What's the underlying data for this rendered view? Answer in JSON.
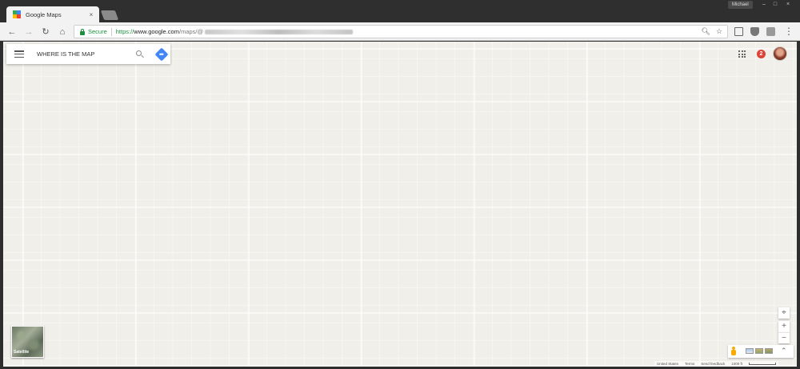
{
  "browser": {
    "tab_title": "Google Maps",
    "tab_close": "×",
    "profile_name": "Michael",
    "window_controls": {
      "minimize": "–",
      "maximize": "□",
      "close": "×"
    },
    "nav": {
      "back": "←",
      "forward": "→",
      "reload": "↻",
      "home": "⌂"
    },
    "omnibox": {
      "secure_label": "Secure",
      "url_scheme": "https://",
      "url_host": "www.google.com",
      "url_path": "/maps/@"
    },
    "omnibox_icons": {
      "zoom": "🔍︎",
      "bookmark": "☆"
    },
    "menu_icon": "⋮"
  },
  "map": {
    "search_value": "WHERE IS THE MAP",
    "notification_count": "2",
    "satellite_label": "Satellite",
    "zoom_in": "+",
    "zoom_out": "−",
    "locate": "⌖",
    "expand": "⌃",
    "footer": {
      "region": "United States",
      "terms": "Terms",
      "feedback": "Send feedback",
      "scale": "1000 ft"
    }
  },
  "colors": {
    "map_background": "#f1efe9",
    "secure_green": "#1e8e3e",
    "directions_blue": "#4285f4",
    "notification_red": "#db4437",
    "pegman_yellow": "#f9ab00"
  }
}
